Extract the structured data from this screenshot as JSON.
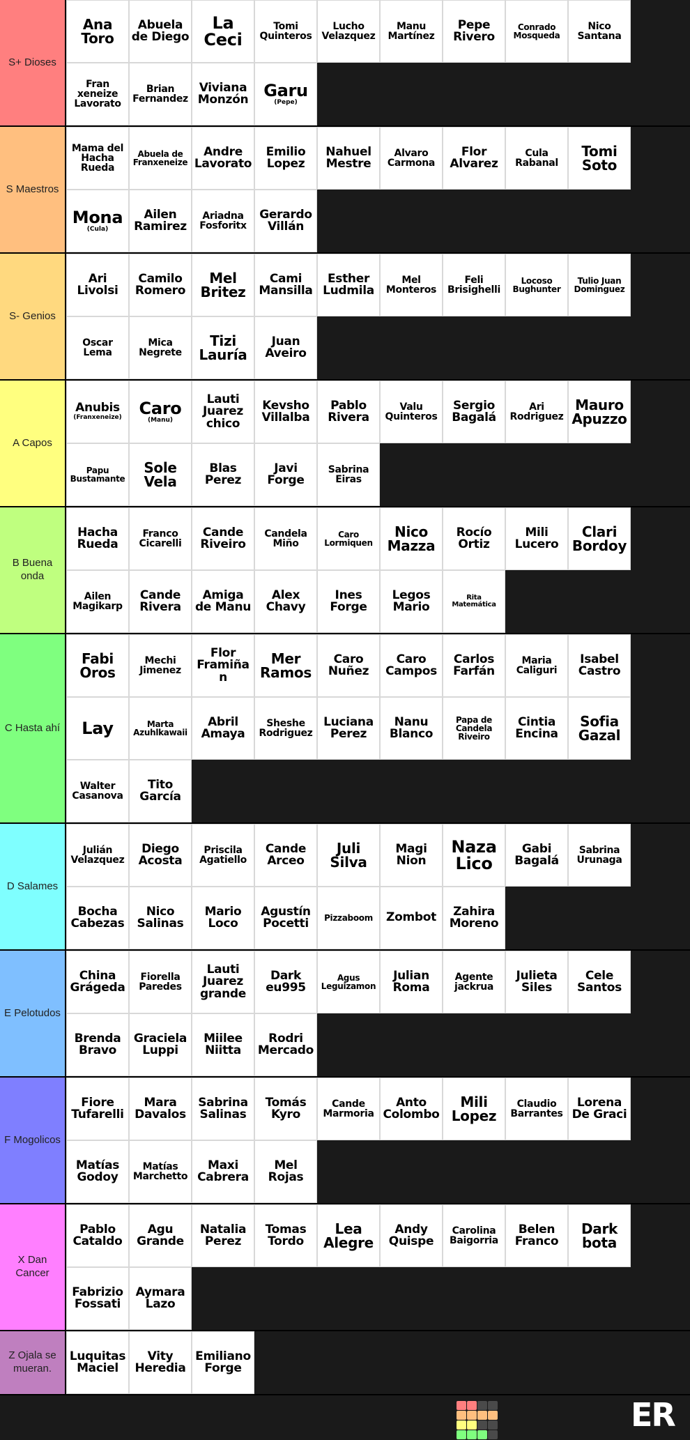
{
  "watermark": {
    "text": "ER",
    "swatches": [
      "#ff7f7f",
      "#ff7f7f",
      "#4a4a4a",
      "#4a4a4a",
      "#ffbf7f",
      "#ffbf7f",
      "#ffbf7f",
      "#ffbf7f",
      "#ffff7f",
      "#ffff7f",
      "#4a4a4a",
      "#4a4a4a",
      "#7fff7f",
      "#7fff7f",
      "#7fff7f",
      "#4a4a4a"
    ]
  },
  "tiers": [
    {
      "label": "S+ Dioses",
      "color": "#ff7f7f",
      "items": [
        {
          "name": "Ana Toro",
          "size": "s-lg"
        },
        {
          "name": "Abuela de Diego",
          "size": "s-md"
        },
        {
          "name": "La Ceci",
          "size": "s-xl"
        },
        {
          "name": "Tomi Quinteros",
          "size": "s-sm"
        },
        {
          "name": "Lucho Velazquez",
          "size": "s-sm"
        },
        {
          "name": "Manu Martínez",
          "size": "s-sm"
        },
        {
          "name": "Pepe Rivero",
          "size": "s-md"
        },
        {
          "name": "Conrado Mosqueda",
          "size": "s-xs"
        },
        {
          "name": "Nico Santana",
          "size": "s-sm"
        },
        {
          "name": "Fran xeneize Lavorato",
          "size": "s-sm"
        },
        {
          "name": "Brian Fernandez",
          "size": "s-sm"
        },
        {
          "name": "Viviana Monzón",
          "size": "s-md"
        },
        {
          "name": "Garu",
          "size": "s-xl",
          "sub": "(Pepe)"
        }
      ]
    },
    {
      "label": "S Maestros",
      "color": "#ffbf7f",
      "items": [
        {
          "name": "Mama del Hacha Rueda",
          "size": "s-sm"
        },
        {
          "name": "Abuela de Franxeneize",
          "size": "s-xs"
        },
        {
          "name": "Andre Lavorato",
          "size": "s-md"
        },
        {
          "name": "Emilio Lopez",
          "size": "s-md"
        },
        {
          "name": "Nahuel Mestre",
          "size": "s-md"
        },
        {
          "name": "Alvaro Carmona",
          "size": "s-sm"
        },
        {
          "name": "Flor Alvarez",
          "size": "s-md"
        },
        {
          "name": "Cula Rabanal",
          "size": "s-sm"
        },
        {
          "name": "Tomi Soto",
          "size": "s-lg"
        },
        {
          "name": "Mona",
          "size": "s-xl",
          "sub": "(Cula)"
        },
        {
          "name": "Ailen Ramirez",
          "size": "s-md"
        },
        {
          "name": "Ariadna Fosforitx",
          "size": "s-sm"
        },
        {
          "name": "Gerardo Villán",
          "size": "s-md"
        }
      ]
    },
    {
      "label": "S- Genios",
      "color": "#ffd97f",
      "items": [
        {
          "name": "Ari Livolsi",
          "size": "s-md"
        },
        {
          "name": "Camilo Romero",
          "size": "s-md"
        },
        {
          "name": "Mel Britez",
          "size": "s-lg"
        },
        {
          "name": "Cami Mansilla",
          "size": "s-md"
        },
        {
          "name": "Esther Ludmila",
          "size": "s-md"
        },
        {
          "name": "Mel Monteros",
          "size": "s-sm"
        },
        {
          "name": "Feli Brisighelli",
          "size": "s-sm"
        },
        {
          "name": "Locoso Bughunter",
          "size": "s-xs"
        },
        {
          "name": "Tulio Juan Dominguez",
          "size": "s-xs"
        },
        {
          "name": "Oscar Lema",
          "size": "s-sm"
        },
        {
          "name": "Mica Negrete",
          "size": "s-sm"
        },
        {
          "name": "Tizi Lauría",
          "size": "s-lg"
        },
        {
          "name": "Juan Aveiro",
          "size": "s-md"
        }
      ]
    },
    {
      "label": "A Capos",
      "color": "#ffff7f",
      "items": [
        {
          "name": "Anubis",
          "size": "s-md",
          "sub": "(Franxeneize)"
        },
        {
          "name": "Caro",
          "size": "s-xl",
          "sub": "(Manu)"
        },
        {
          "name": "Lauti Juarez chico",
          "size": "s-md"
        },
        {
          "name": "Kevsho Villalba",
          "size": "s-md"
        },
        {
          "name": "Pablo Rivera",
          "size": "s-md"
        },
        {
          "name": "Valu Quinteros",
          "size": "s-sm"
        },
        {
          "name": "Sergio Bagalá",
          "size": "s-md"
        },
        {
          "name": "Ari Rodriguez",
          "size": "s-sm"
        },
        {
          "name": "Mauro Apuzzo",
          "size": "s-lg"
        },
        {
          "name": "Papu Bustamante",
          "size": "s-xs"
        },
        {
          "name": "Sole Vela",
          "size": "s-lg"
        },
        {
          "name": "Blas Perez",
          "size": "s-md"
        },
        {
          "name": "Javi Forge",
          "size": "s-md"
        },
        {
          "name": "Sabrina Eiras",
          "size": "s-sm"
        }
      ]
    },
    {
      "label": "B Buena onda",
      "color": "#bfff7f",
      "items": [
        {
          "name": "Hacha Rueda",
          "size": "s-md"
        },
        {
          "name": "Franco Cicarelli",
          "size": "s-sm"
        },
        {
          "name": "Cande Riveiro",
          "size": "s-md"
        },
        {
          "name": "Candela Miño",
          "size": "s-sm"
        },
        {
          "name": "Caro Lormiquen",
          "size": "s-xs"
        },
        {
          "name": "Nico Mazza",
          "size": "s-lg"
        },
        {
          "name": "Rocío Ortiz",
          "size": "s-md"
        },
        {
          "name": "Mili Lucero",
          "size": "s-md"
        },
        {
          "name": "Clari Bordoy",
          "size": "s-lg"
        },
        {
          "name": "Ailen Magikarp",
          "size": "s-sm"
        },
        {
          "name": "Cande Rivera",
          "size": "s-md"
        },
        {
          "name": "Amiga de Manu",
          "size": "s-md"
        },
        {
          "name": "Alex Chavy",
          "size": "s-md"
        },
        {
          "name": "Ines Forge",
          "size": "s-md"
        },
        {
          "name": "Legos Mario",
          "size": "s-md"
        },
        {
          "name": "Rita Matemática",
          "size": "s-xxs"
        }
      ]
    },
    {
      "label": "C Hasta ahí",
      "color": "#7fff7f",
      "items": [
        {
          "name": "Fabi Oros",
          "size": "s-lg"
        },
        {
          "name": "Mechi Jimenez",
          "size": "s-sm"
        },
        {
          "name": "Flor Framiñan",
          "size": "s-md"
        },
        {
          "name": "Mer Ramos",
          "size": "s-lg"
        },
        {
          "name": "Caro Nuñez",
          "size": "s-md"
        },
        {
          "name": "Caro Campos",
          "size": "s-md"
        },
        {
          "name": "Carlos Farfán",
          "size": "s-md"
        },
        {
          "name": "Maria Caliguri",
          "size": "s-sm"
        },
        {
          "name": "Isabel Castro",
          "size": "s-md"
        },
        {
          "name": "Lay",
          "size": "s-xl"
        },
        {
          "name": "Marta Azuhlkawaii",
          "size": "s-xs"
        },
        {
          "name": "Abril Amaya",
          "size": "s-md"
        },
        {
          "name": "Sheshe Rodriguez",
          "size": "s-sm"
        },
        {
          "name": "Luciana Perez",
          "size": "s-md"
        },
        {
          "name": "Nanu Blanco",
          "size": "s-md"
        },
        {
          "name": "Papa de Candela Riveiro",
          "size": "s-xs"
        },
        {
          "name": "Cintia Encina",
          "size": "s-md"
        },
        {
          "name": "Sofia Gazal",
          "size": "s-lg"
        },
        {
          "name": "Walter Casanova",
          "size": "s-sm"
        },
        {
          "name": "Tito García",
          "size": "s-md"
        }
      ]
    },
    {
      "label": "D Salames",
      "color": "#7fffff",
      "items": [
        {
          "name": "Julián Velazquez",
          "size": "s-sm"
        },
        {
          "name": "Diego Acosta",
          "size": "s-md"
        },
        {
          "name": "Priscila Agatiello",
          "size": "s-sm"
        },
        {
          "name": "Cande Arceo",
          "size": "s-md"
        },
        {
          "name": "Juli Silva",
          "size": "s-lg"
        },
        {
          "name": "Magi Nion",
          "size": "s-md"
        },
        {
          "name": "Naza Lico",
          "size": "s-xl"
        },
        {
          "name": "Gabi Bagalá",
          "size": "s-md"
        },
        {
          "name": "Sabrina Urunaga",
          "size": "s-sm"
        },
        {
          "name": "Bocha Cabezas",
          "size": "s-md"
        },
        {
          "name": "Nico Salinas",
          "size": "s-md"
        },
        {
          "name": "Mario Loco",
          "size": "s-md"
        },
        {
          "name": "Agustín Pocetti",
          "size": "s-md"
        },
        {
          "name": "Pizzaboom",
          "size": "s-xs"
        },
        {
          "name": "Zombot",
          "size": "s-md"
        },
        {
          "name": "Zahira Moreno",
          "size": "s-md"
        }
      ]
    },
    {
      "label": "E Pelotudos",
      "color": "#7fbfff",
      "items": [
        {
          "name": "China Grágeda",
          "size": "s-md"
        },
        {
          "name": "Fiorella Paredes",
          "size": "s-sm"
        },
        {
          "name": "Lauti Juarez grande",
          "size": "s-md"
        },
        {
          "name": "Dark eu995",
          "size": "s-md"
        },
        {
          "name": "Agus Leguizamon",
          "size": "s-xs"
        },
        {
          "name": "Julian Roma",
          "size": "s-md"
        },
        {
          "name": "Agente jackrua",
          "size": "s-sm"
        },
        {
          "name": "Julieta Siles",
          "size": "s-md"
        },
        {
          "name": "Cele Santos",
          "size": "s-md"
        },
        {
          "name": "Brenda Bravo",
          "size": "s-md"
        },
        {
          "name": "Graciela Luppi",
          "size": "s-md"
        },
        {
          "name": "Miilee Niitta",
          "size": "s-md"
        },
        {
          "name": "Rodri Mercado",
          "size": "s-md"
        }
      ]
    },
    {
      "label": "F Mogolicos",
      "color": "#7f7fff",
      "items": [
        {
          "name": "Fiore Tufarelli",
          "size": "s-md"
        },
        {
          "name": "Mara Davalos",
          "size": "s-md"
        },
        {
          "name": "Sabrina Salinas",
          "size": "s-md"
        },
        {
          "name": "Tomás Kyro",
          "size": "s-md"
        },
        {
          "name": "Cande Marmoria",
          "size": "s-sm"
        },
        {
          "name": "Anto Colombo",
          "size": "s-md"
        },
        {
          "name": "Mili Lopez",
          "size": "s-lg"
        },
        {
          "name": "Claudio Barrantes",
          "size": "s-sm"
        },
        {
          "name": "Lorena De Graci",
          "size": "s-md"
        },
        {
          "name": "Matías Godoy",
          "size": "s-md"
        },
        {
          "name": "Matías Marchetto",
          "size": "s-sm"
        },
        {
          "name": "Maxi Cabrera",
          "size": "s-md"
        },
        {
          "name": "Mel Rojas",
          "size": "s-md"
        }
      ]
    },
    {
      "label": "X Dan Cancer",
      "color": "#ff7fff",
      "items": [
        {
          "name": "Pablo Cataldo",
          "size": "s-md"
        },
        {
          "name": "Agu Grande",
          "size": "s-md"
        },
        {
          "name": "Natalia Perez",
          "size": "s-md"
        },
        {
          "name": "Tomas Tordo",
          "size": "s-md"
        },
        {
          "name": "Lea Alegre",
          "size": "s-lg"
        },
        {
          "name": "Andy Quispe",
          "size": "s-md"
        },
        {
          "name": "Carolina Baigorria",
          "size": "s-sm"
        },
        {
          "name": "Belen Franco",
          "size": "s-md"
        },
        {
          "name": "Dark bota",
          "size": "s-lg"
        },
        {
          "name": "Fabrizio Fossati",
          "size": "s-md"
        },
        {
          "name": "Aymara Lazo",
          "size": "s-md"
        }
      ]
    },
    {
      "label": "Z Ojala se mueran.",
      "color": "#bf7fbf",
      "items": [
        {
          "name": "Luquitas Maciel",
          "size": "s-md"
        },
        {
          "name": "Vity Heredia",
          "size": "s-md"
        },
        {
          "name": "Emiliano Forge",
          "size": "s-md"
        }
      ]
    }
  ]
}
